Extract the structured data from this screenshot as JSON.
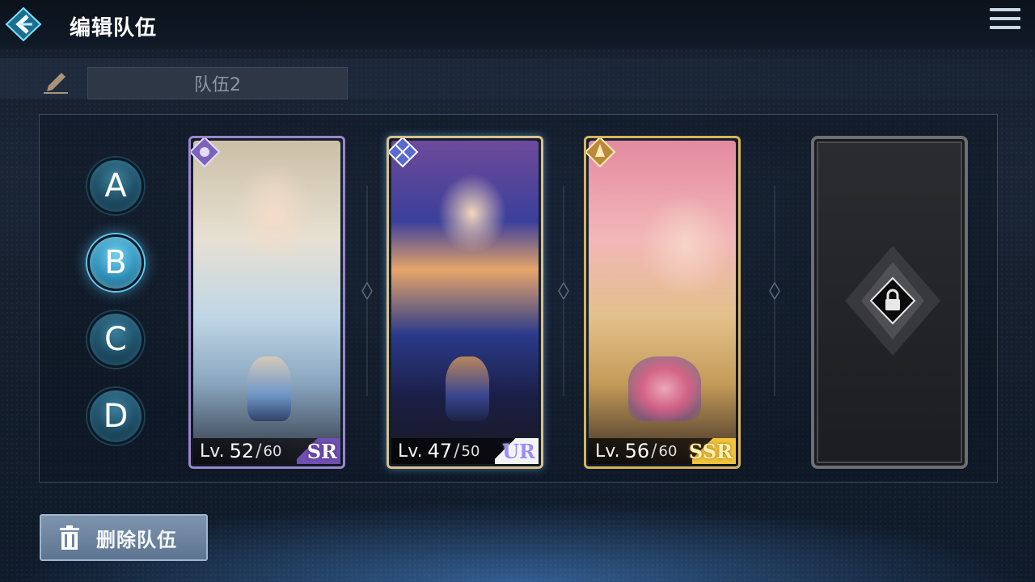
{
  "header": {
    "title": "编辑队伍",
    "back_icon": "back-arrow-icon",
    "menu_icon": "hamburger-menu-icon"
  },
  "team": {
    "name": "队伍2",
    "edit_icon": "pencil-icon"
  },
  "slots": [
    {
      "label": "A",
      "active": false
    },
    {
      "label": "B",
      "active": true
    },
    {
      "label": "C",
      "active": false
    },
    {
      "label": "D",
      "active": false
    }
  ],
  "units": [
    {
      "level_prefix": "Lv.",
      "level": "52",
      "sep": "/",
      "max_level": "60",
      "rarity": "SR",
      "frame_color": "#9a86c8"
    },
    {
      "level_prefix": "Lv.",
      "level": "47",
      "sep": "/",
      "max_level": "50",
      "rarity": "UR",
      "frame_color": "#d8c28a"
    },
    {
      "level_prefix": "Lv.",
      "level": "56",
      "sep": "/",
      "max_level": "60",
      "rarity": "SSR",
      "frame_color": "#d8b35a"
    }
  ],
  "locked_slot": {
    "icon": "lock-icon"
  },
  "footer": {
    "delete_label": "删除队伍",
    "delete_icon": "trash-icon"
  },
  "colors": {
    "accent": "#5fc7ee",
    "delete_button": "#6f86a1"
  }
}
